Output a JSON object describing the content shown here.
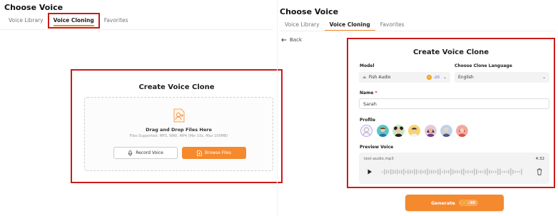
{
  "left": {
    "title": "Choose Voice",
    "tabs": [
      "Voice Library",
      "Voice Cloning",
      "Favorites"
    ],
    "box_title": "Create Voice Clone",
    "drop_title": "Drag and Drop Files Here",
    "drop_sub": "Files Supported: MP3, WAV, MP4 (Min 10s, Max 100MB)",
    "record_label": "Record Voice",
    "browse_label": "Browse Files"
  },
  "right": {
    "title": "Choose Voice",
    "tabs": [
      "Voice Library",
      "Voice Cloning",
      "Favorites"
    ],
    "back_label": "Back",
    "box_title": "Create Voice Clone",
    "model_label": "Model",
    "model_value": "Fish Audio",
    "model_cost": "-20",
    "lang_label": "Choose Clone Language",
    "lang_value": "English",
    "name_label": "Name",
    "name_required": "*",
    "name_value": "Sarah",
    "profile_label": "Profile",
    "preview_label": "Preview Voice",
    "audio_file": "test-audio.mp3",
    "audio_duration": "4:32",
    "generate_label": "Generate",
    "generate_cost": "-30"
  },
  "colors": {
    "accent": "#f5892e",
    "highlight_border": "#c91a1a",
    "cost_text": "#8a4dd6"
  },
  "icons": {
    "upload": "person-upload-icon",
    "record": "microphone-icon",
    "browse": "file-upload-icon",
    "back": "arrow-left-icon",
    "model": "fish-icon",
    "coin": "coin-icon",
    "play": "play-icon",
    "trash": "trash-icon"
  }
}
